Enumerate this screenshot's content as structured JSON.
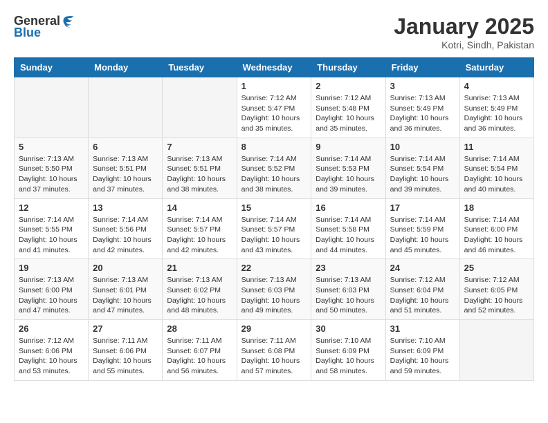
{
  "header": {
    "logo_general": "General",
    "logo_blue": "Blue",
    "month": "January 2025",
    "location": "Kotri, Sindh, Pakistan"
  },
  "weekdays": [
    "Sunday",
    "Monday",
    "Tuesday",
    "Wednesday",
    "Thursday",
    "Friday",
    "Saturday"
  ],
  "weeks": [
    [
      {
        "day": "",
        "info": ""
      },
      {
        "day": "",
        "info": ""
      },
      {
        "day": "",
        "info": ""
      },
      {
        "day": "1",
        "info": "Sunrise: 7:12 AM\nSunset: 5:47 PM\nDaylight: 10 hours\nand 35 minutes."
      },
      {
        "day": "2",
        "info": "Sunrise: 7:12 AM\nSunset: 5:48 PM\nDaylight: 10 hours\nand 35 minutes."
      },
      {
        "day": "3",
        "info": "Sunrise: 7:13 AM\nSunset: 5:49 PM\nDaylight: 10 hours\nand 36 minutes."
      },
      {
        "day": "4",
        "info": "Sunrise: 7:13 AM\nSunset: 5:49 PM\nDaylight: 10 hours\nand 36 minutes."
      }
    ],
    [
      {
        "day": "5",
        "info": "Sunrise: 7:13 AM\nSunset: 5:50 PM\nDaylight: 10 hours\nand 37 minutes."
      },
      {
        "day": "6",
        "info": "Sunrise: 7:13 AM\nSunset: 5:51 PM\nDaylight: 10 hours\nand 37 minutes."
      },
      {
        "day": "7",
        "info": "Sunrise: 7:13 AM\nSunset: 5:51 PM\nDaylight: 10 hours\nand 38 minutes."
      },
      {
        "day": "8",
        "info": "Sunrise: 7:14 AM\nSunset: 5:52 PM\nDaylight: 10 hours\nand 38 minutes."
      },
      {
        "day": "9",
        "info": "Sunrise: 7:14 AM\nSunset: 5:53 PM\nDaylight: 10 hours\nand 39 minutes."
      },
      {
        "day": "10",
        "info": "Sunrise: 7:14 AM\nSunset: 5:54 PM\nDaylight: 10 hours\nand 39 minutes."
      },
      {
        "day": "11",
        "info": "Sunrise: 7:14 AM\nSunset: 5:54 PM\nDaylight: 10 hours\nand 40 minutes."
      }
    ],
    [
      {
        "day": "12",
        "info": "Sunrise: 7:14 AM\nSunset: 5:55 PM\nDaylight: 10 hours\nand 41 minutes."
      },
      {
        "day": "13",
        "info": "Sunrise: 7:14 AM\nSunset: 5:56 PM\nDaylight: 10 hours\nand 42 minutes."
      },
      {
        "day": "14",
        "info": "Sunrise: 7:14 AM\nSunset: 5:57 PM\nDaylight: 10 hours\nand 42 minutes."
      },
      {
        "day": "15",
        "info": "Sunrise: 7:14 AM\nSunset: 5:57 PM\nDaylight: 10 hours\nand 43 minutes."
      },
      {
        "day": "16",
        "info": "Sunrise: 7:14 AM\nSunset: 5:58 PM\nDaylight: 10 hours\nand 44 minutes."
      },
      {
        "day": "17",
        "info": "Sunrise: 7:14 AM\nSunset: 5:59 PM\nDaylight: 10 hours\nand 45 minutes."
      },
      {
        "day": "18",
        "info": "Sunrise: 7:14 AM\nSunset: 6:00 PM\nDaylight: 10 hours\nand 46 minutes."
      }
    ],
    [
      {
        "day": "19",
        "info": "Sunrise: 7:13 AM\nSunset: 6:00 PM\nDaylight: 10 hours\nand 47 minutes."
      },
      {
        "day": "20",
        "info": "Sunrise: 7:13 AM\nSunset: 6:01 PM\nDaylight: 10 hours\nand 47 minutes."
      },
      {
        "day": "21",
        "info": "Sunrise: 7:13 AM\nSunset: 6:02 PM\nDaylight: 10 hours\nand 48 minutes."
      },
      {
        "day": "22",
        "info": "Sunrise: 7:13 AM\nSunset: 6:03 PM\nDaylight: 10 hours\nand 49 minutes."
      },
      {
        "day": "23",
        "info": "Sunrise: 7:13 AM\nSunset: 6:03 PM\nDaylight: 10 hours\nand 50 minutes."
      },
      {
        "day": "24",
        "info": "Sunrise: 7:12 AM\nSunset: 6:04 PM\nDaylight: 10 hours\nand 51 minutes."
      },
      {
        "day": "25",
        "info": "Sunrise: 7:12 AM\nSunset: 6:05 PM\nDaylight: 10 hours\nand 52 minutes."
      }
    ],
    [
      {
        "day": "26",
        "info": "Sunrise: 7:12 AM\nSunset: 6:06 PM\nDaylight: 10 hours\nand 53 minutes."
      },
      {
        "day": "27",
        "info": "Sunrise: 7:11 AM\nSunset: 6:06 PM\nDaylight: 10 hours\nand 55 minutes."
      },
      {
        "day": "28",
        "info": "Sunrise: 7:11 AM\nSunset: 6:07 PM\nDaylight: 10 hours\nand 56 minutes."
      },
      {
        "day": "29",
        "info": "Sunrise: 7:11 AM\nSunset: 6:08 PM\nDaylight: 10 hours\nand 57 minutes."
      },
      {
        "day": "30",
        "info": "Sunrise: 7:10 AM\nSunset: 6:09 PM\nDaylight: 10 hours\nand 58 minutes."
      },
      {
        "day": "31",
        "info": "Sunrise: 7:10 AM\nSunset: 6:09 PM\nDaylight: 10 hours\nand 59 minutes."
      },
      {
        "day": "",
        "info": ""
      }
    ]
  ]
}
